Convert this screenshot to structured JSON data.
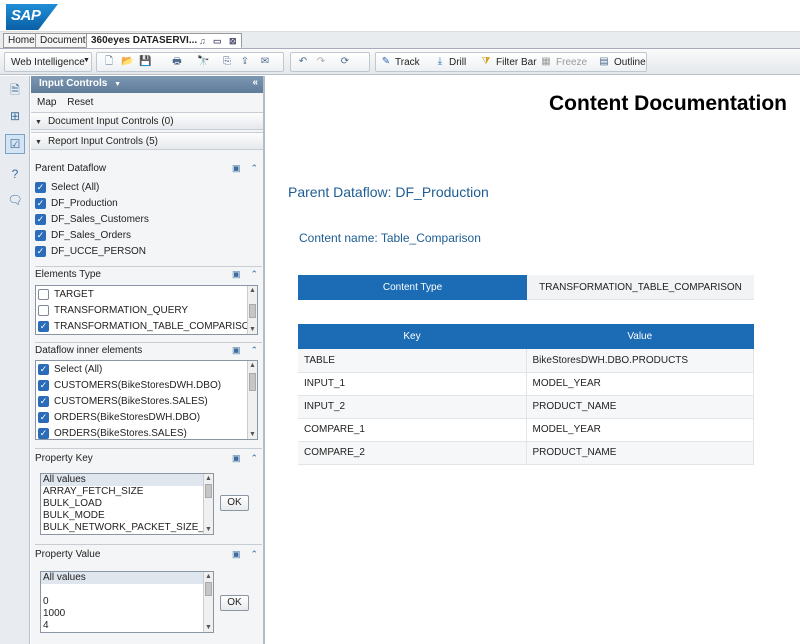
{
  "logo": "SAP",
  "tabs": [
    "Home",
    "Documents",
    "360eyes DATASERVI..."
  ],
  "toolbar": {
    "web_intelligence": "Web Intelligence",
    "track": "Track",
    "drill": "Drill",
    "filter_bar": "Filter Bar",
    "freeze": "Freeze",
    "outline": "Outline"
  },
  "panel": {
    "title": "Input Controls",
    "menu": [
      "Map",
      "Reset"
    ],
    "doc_section": "Document Input Controls (0)",
    "report_section": "Report Input Controls (5)",
    "parent_dataflow": {
      "title": "Parent Dataflow",
      "items": [
        {
          "label": "Select (All)",
          "checked": true
        },
        {
          "label": "DF_Production",
          "checked": true
        },
        {
          "label": "DF_Sales_Customers",
          "checked": true
        },
        {
          "label": "DF_Sales_Orders",
          "checked": true
        },
        {
          "label": "DF_UCCE_PERSON",
          "checked": true
        }
      ]
    },
    "elements_type": {
      "title": "Elements Type",
      "items": [
        {
          "label": "TARGET",
          "checked": false
        },
        {
          "label": "TRANSFORMATION_QUERY",
          "checked": false
        },
        {
          "label": "TRANSFORMATION_TABLE_COMPARISON",
          "checked": true
        }
      ]
    },
    "dataflow_inner": {
      "title": "Dataflow inner elements",
      "items": [
        {
          "label": "Select (All)",
          "checked": true
        },
        {
          "label": "CUSTOMERS(BikeStoresDWH.DBO)",
          "checked": true
        },
        {
          "label": "CUSTOMERS(BikeStores.SALES)",
          "checked": true
        },
        {
          "label": "ORDERS(BikeStoresDWH.DBO)",
          "checked": true
        },
        {
          "label": "ORDERS(BikeStores.SALES)",
          "checked": true
        }
      ]
    },
    "property_key": {
      "title": "Property Key",
      "items": [
        "All values",
        "ARRAY_FETCH_SIZE",
        "BULK_LOAD",
        "BULK_MODE",
        "BULK_NETWORK_PACKET_SIZE_KB"
      ],
      "ok": "OK"
    },
    "property_value": {
      "title": "Property Value",
      "items": [
        "All values",
        "",
        "0",
        "1000",
        "4"
      ],
      "ok": "OK"
    }
  },
  "report": {
    "title": "Content Documentation",
    "parent_dataflow": "Parent Dataflow: DF_Production",
    "content_name": "Content name: Table_Comparison",
    "content_type_label": "Content Type",
    "content_type_value": "TRANSFORMATION_TABLE_COMPARISON",
    "table": {
      "headers": [
        "Key",
        "Value"
      ],
      "rows": [
        [
          "TABLE",
          "BikeStoresDWH.DBO.PRODUCTS"
        ],
        [
          "INPUT_1",
          "MODEL_YEAR"
        ],
        [
          "INPUT_2",
          "PRODUCT_NAME"
        ],
        [
          "COMPARE_1",
          "MODEL_YEAR"
        ],
        [
          "COMPARE_2",
          "PRODUCT_NAME"
        ]
      ]
    }
  }
}
